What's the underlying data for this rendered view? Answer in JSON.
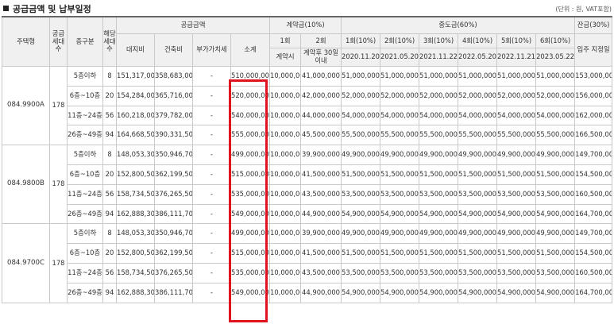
{
  "heading": "공급금액 및 납부일정",
  "unit_note": "(단위 : 원, VAT포함)",
  "headers": {
    "house_type": "주택형",
    "supply_units": "공급세대수",
    "floor_group": "층구분",
    "applicable_units": "해당세대수",
    "supply_amount": "공급금액",
    "land": "대지비",
    "building": "건축비",
    "vat": "부가가치세",
    "subtotal": "소계",
    "contract": "계약금(10%)",
    "installment_1": "1회",
    "installment_2": "2회",
    "on_contract": "계약시",
    "within_30": "계약후 30일이내",
    "middle": "중도금(60%)",
    "middle_rounds": [
      "1회(10%)",
      "2회(10%)",
      "3회(10%)",
      "4회(10%)",
      "5회(10%)",
      "6회(10%)"
    ],
    "middle_dates": [
      "2020.11.20",
      "2021.05.20",
      "2021.11.22",
      "2022.05.20",
      "2022.11.21",
      "2023.05.22"
    ],
    "balance": "잔금(30%)",
    "move_in": "입주 지정일"
  },
  "groups": [
    {
      "type": "084.9900A",
      "units": "178",
      "rows": [
        {
          "floor": "5층이하",
          "count": "8",
          "land": "151,317,000",
          "building": "358,683,000",
          "vat": "-",
          "subtotal": "510,000,000",
          "c1": "10,000,000",
          "c2": "41,000,000",
          "m": [
            "51,000,000",
            "51,000,000",
            "51,000,000",
            "51,000,000",
            "51,000,000",
            "51,000,000"
          ],
          "balance": "153,000,000"
        },
        {
          "floor": "6층~10층",
          "count": "20",
          "land": "154,284,000",
          "building": "365,716,000",
          "vat": "-",
          "subtotal": "520,000,000",
          "c1": "10,000,000",
          "c2": "42,000,000",
          "m": [
            "52,000,000",
            "52,000,000",
            "52,000,000",
            "52,000,000",
            "52,000,000",
            "52,000,000"
          ],
          "balance": "156,000,000"
        },
        {
          "floor": "11층~24층",
          "count": "56",
          "land": "160,218,000",
          "building": "379,782,000",
          "vat": "-",
          "subtotal": "540,000,000",
          "c1": "10,000,000",
          "c2": "44,000,000",
          "m": [
            "54,000,000",
            "54,000,000",
            "54,000,000",
            "54,000,000",
            "54,000,000",
            "54,000,000"
          ],
          "balance": "162,000,000"
        },
        {
          "floor": "26층~49층",
          "count": "94",
          "land": "164,668,500",
          "building": "390,331,500",
          "vat": "-",
          "subtotal": "555,000,000",
          "c1": "10,000,000",
          "c2": "45,500,000",
          "m": [
            "55,500,000",
            "55,500,000",
            "55,500,000",
            "55,500,000",
            "55,500,000",
            "55,500,000"
          ],
          "balance": "166,500,000"
        }
      ]
    },
    {
      "type": "084.9800B",
      "units": "178",
      "rows": [
        {
          "floor": "5층이하",
          "count": "8",
          "land": "148,053,300",
          "building": "350,946,700",
          "vat": "-",
          "subtotal": "499,000,000",
          "c1": "10,000,000",
          "c2": "39,900,000",
          "m": [
            "49,900,000",
            "49,900,000",
            "49,900,000",
            "49,900,000",
            "49,900,000",
            "49,900,000"
          ],
          "balance": "149,700,000"
        },
        {
          "floor": "6층~10층",
          "count": "20",
          "land": "152,800,500",
          "building": "362,199,500",
          "vat": "-",
          "subtotal": "515,000,000",
          "c1": "10,000,000",
          "c2": "41,500,000",
          "m": [
            "51,500,000",
            "51,500,000",
            "51,500,000",
            "51,500,000",
            "51,500,000",
            "51,500,000"
          ],
          "balance": "154,500,000"
        },
        {
          "floor": "11층~24층",
          "count": "56",
          "land": "158,734,500",
          "building": "376,265,500",
          "vat": "-",
          "subtotal": "535,000,000",
          "c1": "10,000,000",
          "c2": "43,500,000",
          "m": [
            "53,500,000",
            "53,500,000",
            "53,500,000",
            "53,500,000",
            "53,500,000",
            "53,500,000"
          ],
          "balance": "160,500,000"
        },
        {
          "floor": "26층~49층",
          "count": "94",
          "land": "162,888,300",
          "building": "386,111,700",
          "vat": "-",
          "subtotal": "549,000,000",
          "c1": "10,000,000",
          "c2": "44,900,000",
          "m": [
            "54,900,000",
            "54,900,000",
            "54,900,000",
            "54,900,000",
            "54,900,000",
            "54,900,000"
          ],
          "balance": "164,700,000"
        }
      ]
    },
    {
      "type": "084.9700C",
      "units": "178",
      "rows": [
        {
          "floor": "5층이하",
          "count": "8",
          "land": "148,053,300",
          "building": "350,946,700",
          "vat": "-",
          "subtotal": "499,000,000",
          "c1": "10,000,000",
          "c2": "39,900,000",
          "m": [
            "49,900,000",
            "49,900,000",
            "49,900,000",
            "49,900,000",
            "49,900,000",
            "49,900,000"
          ],
          "balance": "149,700,000"
        },
        {
          "floor": "6층~10층",
          "count": "20",
          "land": "152,800,500",
          "building": "362,199,500",
          "vat": "-",
          "subtotal": "515,000,000",
          "c1": "10,000,000",
          "c2": "41,500,000",
          "m": [
            "51,500,000",
            "51,500,000",
            "51,500,000",
            "51,500,000",
            "51,500,000",
            "51,500,000"
          ],
          "balance": "154,500,000"
        },
        {
          "floor": "11층~24층",
          "count": "56",
          "land": "158,734,500",
          "building": "376,265,500",
          "vat": "-",
          "subtotal": "535,000,000",
          "c1": "10,000,000",
          "c2": "43,500,000",
          "m": [
            "53,500,000",
            "53,500,000",
            "53,500,000",
            "53,500,000",
            "53,500,000",
            "53,500,000"
          ],
          "balance": "160,500,000"
        },
        {
          "floor": "26층~49층",
          "count": "94",
          "land": "162,888,300",
          "building": "386,111,700",
          "vat": "-",
          "subtotal": "549,000,000",
          "c1": "10,000,000",
          "c2": "44,900,000",
          "m": [
            "54,900,000",
            "54,900,000",
            "54,900,000",
            "54,900,000",
            "54,900,000",
            "54,900,000"
          ],
          "balance": "164,700,000"
        }
      ]
    }
  ],
  "highlight_color": "#e0141e"
}
